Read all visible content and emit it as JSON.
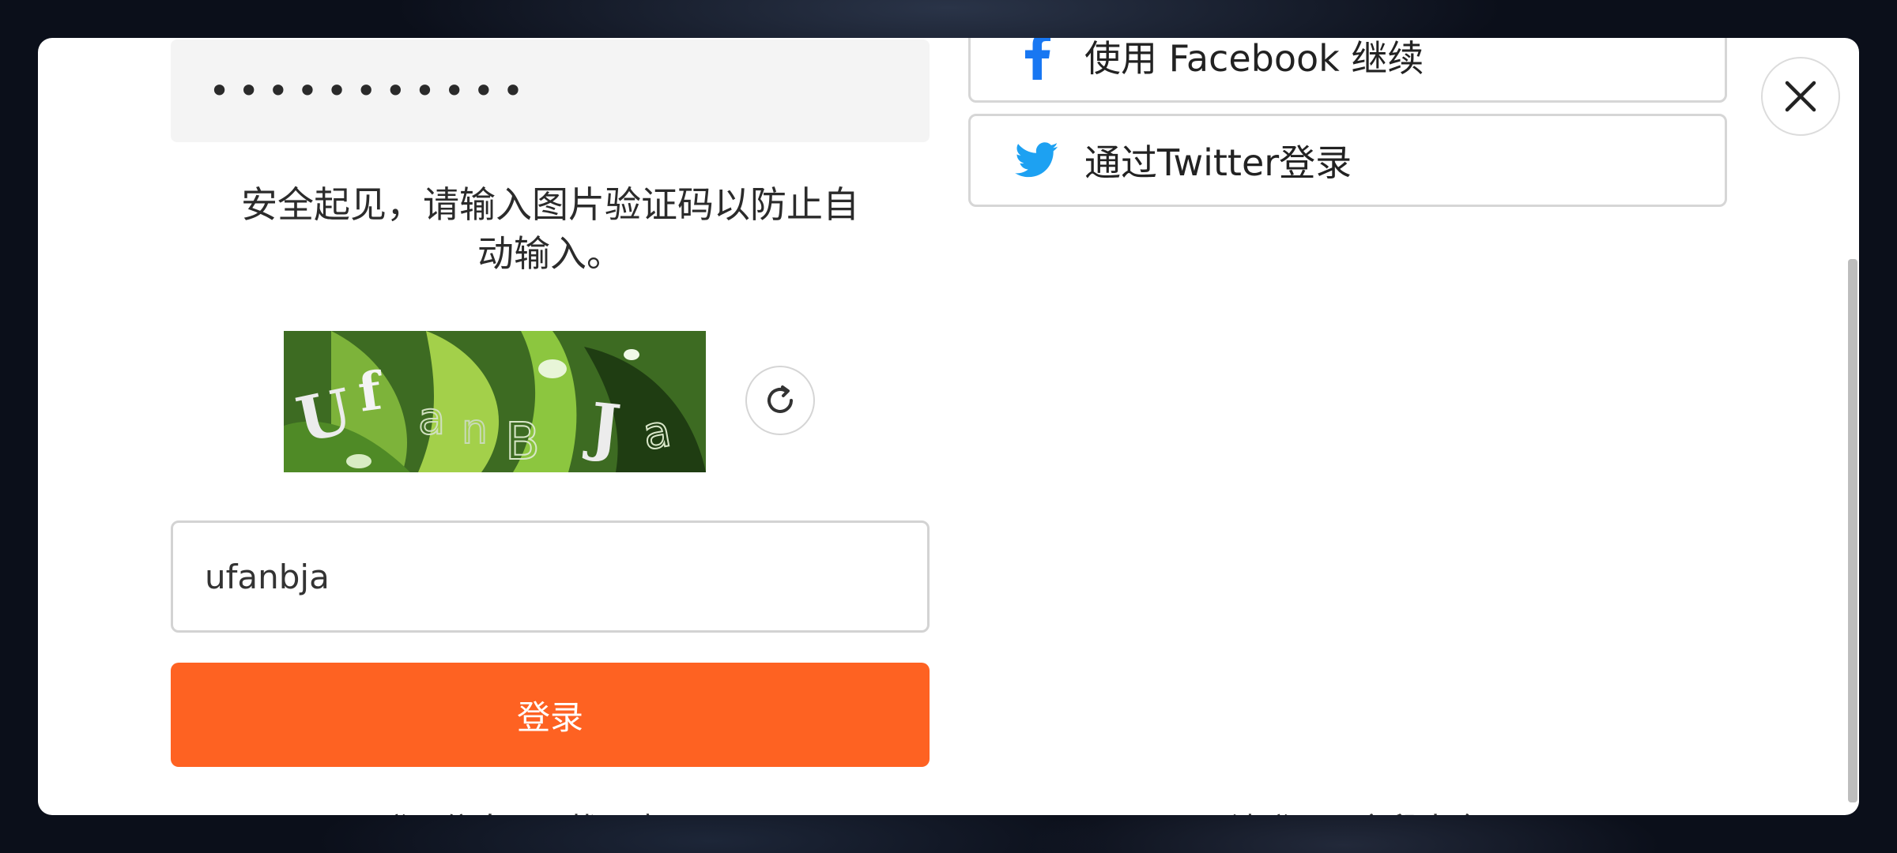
{
  "login_form": {
    "password_mask": "•••••••••••",
    "notice_line1": "安全起见，请输入图片验证码以防止自",
    "notice_line2": "动输入。",
    "captcha_text": "ufanBJa",
    "code_value": "ufanbja",
    "submit_label": "登录",
    "bottom_left_text": "登录信息……找回密码",
    "bottom_right_text": "无法登录？字段大全"
  },
  "social": {
    "facebook_label": "使用 Facebook 继续",
    "twitter_label": "通过Twitter登录"
  },
  "icons": {
    "facebook": "facebook-icon",
    "twitter": "twitter-icon",
    "refresh": "refresh-icon",
    "close": "close-icon"
  },
  "colors": {
    "accent": "#fe6222",
    "facebook": "#1877f2",
    "twitter": "#1da1f2"
  }
}
